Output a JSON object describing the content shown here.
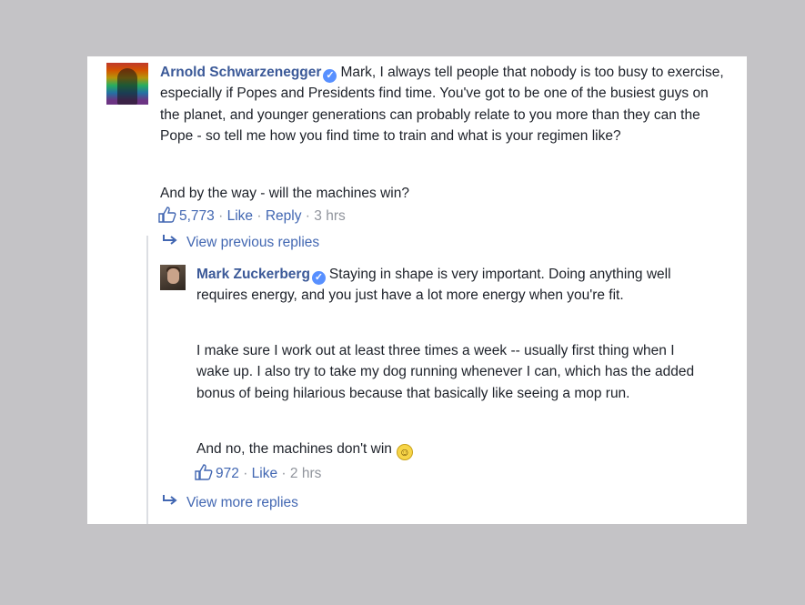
{
  "comment": {
    "author": "Arnold Schwarzenegger",
    "body_p1": "Mark, I always tell people that nobody is too busy to exercise, especially if Popes and Presidents find time. You've got to be one of the busiest guys on the planet, and younger generations can probably relate to you more than they can the Pope - so tell me how you find time to train and what is your regimen like?",
    "body_p2": "And by the way - will the machines win?",
    "likes": "5,773",
    "like_label": "Like",
    "reply_label": "Reply",
    "sep": "·",
    "time": "3 hrs"
  },
  "view_previous": "View previous replies",
  "reply": {
    "author": "Mark Zuckerberg",
    "body_p1": "Staying in shape is very important. Doing anything well requires energy, and you just have a lot more energy when you're fit.",
    "body_p2": "I make sure I work out at least three times a week -- usually first thing when I wake up. I also try to take my dog running whenever I can, which has the added bonus of being hilarious because that basically like seeing a mop run.",
    "body_p3": "And no, the machines don't win",
    "likes": "972",
    "like_label": "Like",
    "sep": "·",
    "time": "2 hrs"
  },
  "view_more": "View more replies",
  "icons": {
    "verified": "verified-badge-icon",
    "like": "thumbs-up-icon",
    "reply_arrow": "reply-arrow-icon",
    "emoji": "smiley-emoji-icon"
  },
  "colors": {
    "link": "#3b5998",
    "meta": "#90949c",
    "text": "#1d2129",
    "background": "#c4c3c6"
  }
}
